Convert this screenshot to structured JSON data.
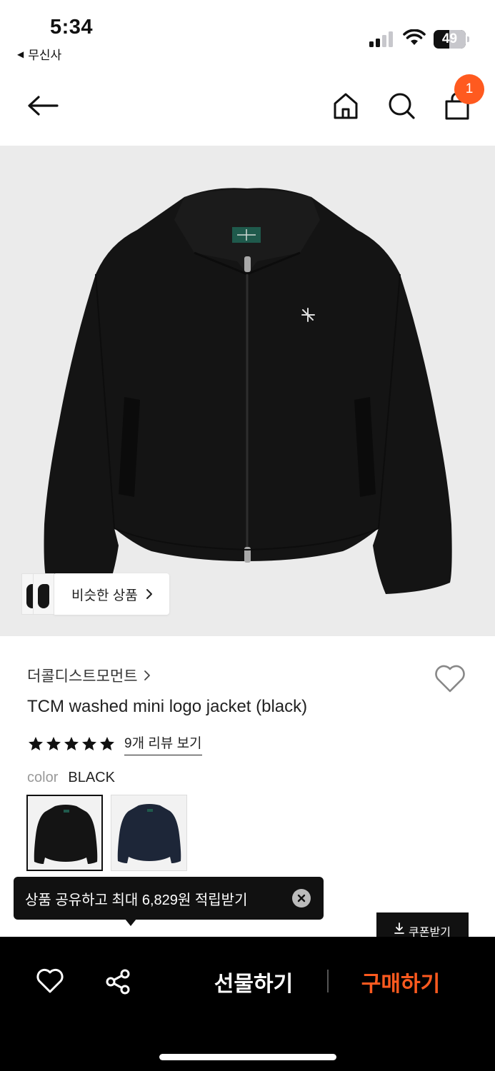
{
  "status_bar": {
    "time": "5:34",
    "back_app": "무신사",
    "battery": "49"
  },
  "nav": {
    "cart_count": "1"
  },
  "image": {
    "similar_label": "비슷한 상품"
  },
  "product": {
    "brand": "더콜디스트모먼트",
    "name": "TCM washed mini logo jacket (black)",
    "rating_stars": 5,
    "review_link": "9개 리뷰 보기",
    "color_label": "color",
    "color_value": "BLACK"
  },
  "color_options": [
    {
      "name": "black",
      "color": "#141414",
      "selected": true
    },
    {
      "name": "navy",
      "color": "#1d2638",
      "selected": false
    }
  ],
  "tooltip": {
    "text": "상품 공유하고 최대 6,829원 적립받기"
  },
  "coupon": {
    "label": "쿠폰받기"
  },
  "bottom_bar": {
    "gift_label": "선물하기",
    "buy_label": "구매하기"
  },
  "colors": {
    "accent": "#ff5a1f",
    "bottom_bar": "#000000",
    "image_bg": "#ebebeb"
  }
}
